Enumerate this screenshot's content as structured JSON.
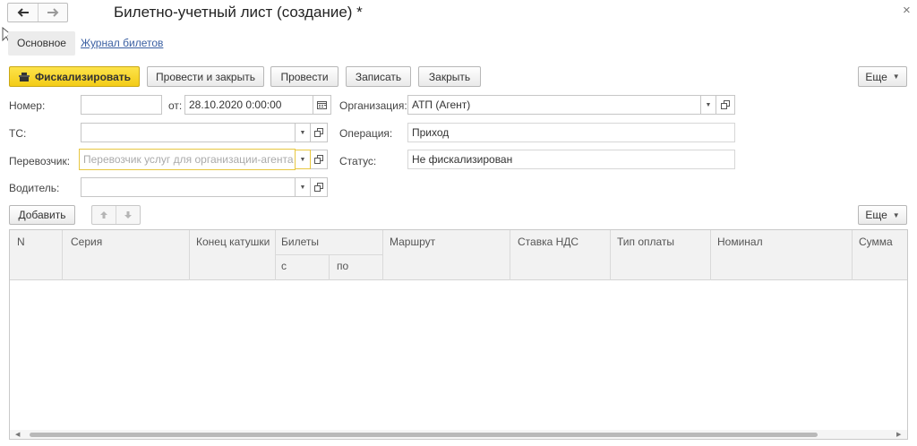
{
  "window": {
    "title": "Билетно-учетный лист (создание) *",
    "close_symbol": "×"
  },
  "tabs": [
    {
      "label": "Основное"
    },
    {
      "label": "Журнал билетов"
    }
  ],
  "toolbar": {
    "fiscalize_label": "Фискализировать",
    "post_close_label": "Провести и закрыть",
    "post_label": "Провести",
    "write_label": "Записать",
    "close_label": "Закрыть",
    "more_label": "Еще"
  },
  "form": {
    "number": {
      "label": "Номер:",
      "value": ""
    },
    "date": {
      "label": "от:",
      "value": "28.10.2020  0:00:00"
    },
    "organization": {
      "label": "Организация:",
      "value": "АТП (Агент)"
    },
    "vehicle": {
      "label": "ТС:",
      "value": ""
    },
    "operation": {
      "label": "Операция:",
      "value": "Приход"
    },
    "carrier": {
      "label": "Перевозчик:",
      "value": "",
      "placeholder": "Перевозчик услуг для организации-агента"
    },
    "status": {
      "label": "Статус:",
      "value": "Не фискализирован"
    },
    "driver": {
      "label": "Водитель:",
      "value": ""
    }
  },
  "table_toolbar": {
    "add_label": "Добавить",
    "more_label": "Еще"
  },
  "table": {
    "columns": {
      "n": "N",
      "series": "Серия",
      "reel_end": "Конец катушки",
      "tickets": "Билеты",
      "from": "с",
      "to": "по",
      "route": "Маршрут",
      "vat": "Ставка НДС",
      "payment": "Тип оплаты",
      "denomination": "Номинал",
      "sum": "Сумма"
    },
    "rows": []
  },
  "colors": {
    "primary_button": "#f5d21f",
    "link": "#3a5fa2",
    "required_border": "#e8c740"
  },
  "icons": [
    "back-arrow-icon",
    "forward-arrow-icon",
    "close-icon",
    "cash-register-icon",
    "calendar-icon",
    "dropdown-icon",
    "open-icon",
    "move-up-icon",
    "move-down-icon"
  ]
}
